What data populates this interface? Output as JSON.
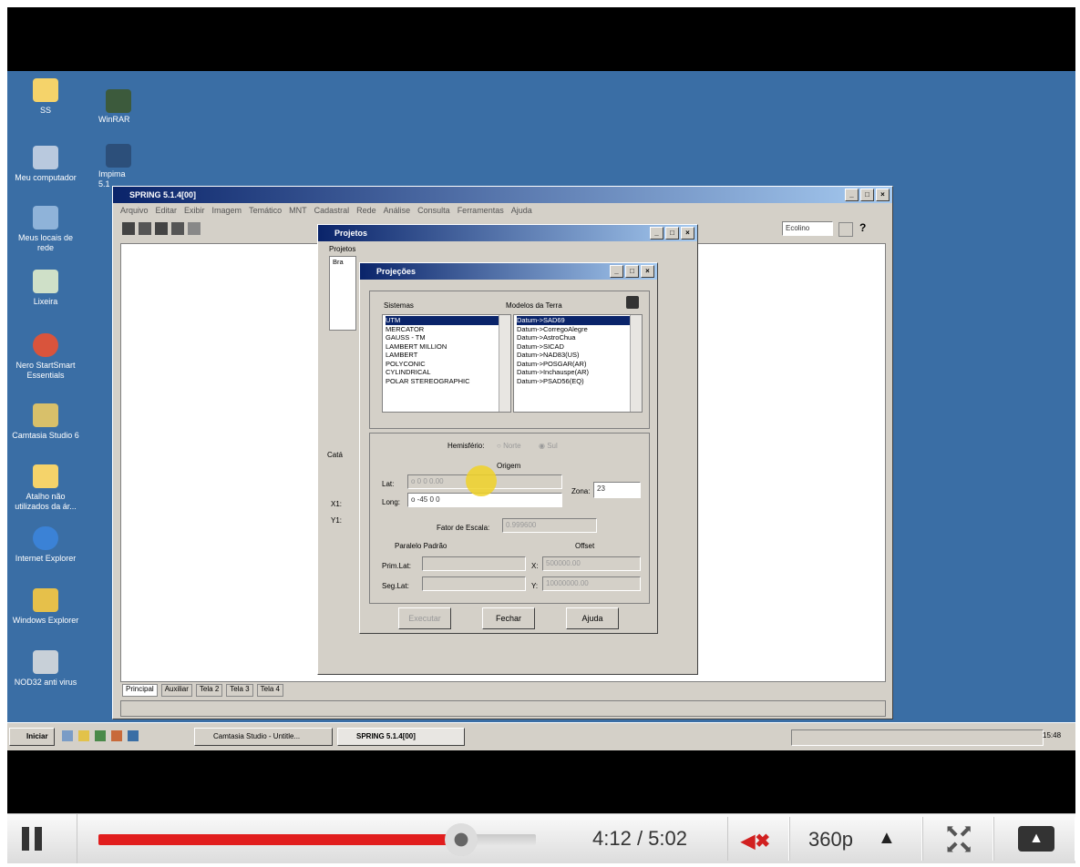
{
  "desktop_icons": [
    {
      "label": "SS"
    },
    {
      "label": "Meu computador"
    },
    {
      "label": "Meus locais de rede"
    },
    {
      "label": "Lixeira"
    },
    {
      "label": "Nero StartSmart Essentials"
    },
    {
      "label": "Camtasia Studio 6"
    },
    {
      "label": "Atalho não utilizados da ár..."
    },
    {
      "label": "Internet Explorer"
    },
    {
      "label": "Windows Explorer"
    },
    {
      "label": "NOD32 anti virus"
    }
  ],
  "desktop_icons_col2": [
    {
      "label": "WinRAR"
    },
    {
      "label": "Impima 5.1"
    }
  ],
  "spring_window": {
    "title": "SPRING 5.1.4[00]",
    "menu": [
      "Arquivo",
      "Editar",
      "Exibir",
      "Imagem",
      "Temático",
      "MNT",
      "Cadastral",
      "Rede",
      "Análise",
      "Consulta",
      "Ferramentas",
      "Ajuda"
    ],
    "tabs": [
      "Principal",
      "Auxiliar",
      "Tela 2",
      "Tela 3",
      "Tela 4"
    ],
    "combo_value": "Ecolino"
  },
  "projetos_dialog": {
    "title": "Projetos",
    "group_label": "Projetos",
    "list_item": "Bra",
    "labels": {
      "cat": "Catá",
      "x1": "X1:",
      "y1": "Y1:"
    }
  },
  "projecoes_dialog": {
    "title": "Projeções",
    "sistemas_label": "Sistemas",
    "modelos_label": "Modelos da Terra",
    "sistemas": [
      "UTM",
      "MERCATOR",
      "GAUSS - TM",
      "LAMBERT MILLION",
      "LAMBERT",
      "POLYCONIC",
      "CYLINDRICAL",
      "POLAR STEREOGRAPHIC"
    ],
    "modelos": [
      "Datum->SAD69",
      "Datum->CorregoAlegre",
      "Datum->AstroChua",
      "Datum->SICAD",
      "Datum->NAD83(US)",
      "Datum->POSGAR(AR)",
      "Datum->Inchauspe(AR)",
      "Datum->PSAD56(EQ)"
    ],
    "hemisferio_label": "Hemisfério:",
    "norte_label": "Norte",
    "sul_label": "Sul",
    "origem_label": "Origem",
    "lat_label": "Lat:",
    "lat_value": "o 0 0 0.00",
    "long_label": "Long:",
    "long_value": "o -45 0 0",
    "zona_label": "Zona:",
    "zona_value": "23",
    "fator_label": "Fator de Escala:",
    "fator_value": "0.999600",
    "paralelo_label": "Paralelo Padrão",
    "offset_label": "Offset",
    "prim_lat_label": "Prim.Lat:",
    "seg_lat_label": "Seg.Lat:",
    "x_label": "X:",
    "x_value": "500000.00",
    "y_label": "Y:",
    "y_value": "10000000.00",
    "buttons": {
      "executar": "Executar",
      "fechar": "Fechar",
      "ajuda": "Ajuda"
    }
  },
  "taskbar": {
    "start_label": "Iniciar",
    "items": [
      "Camtasia Studio - Untitle...",
      "SPRING 5.1.4[00]"
    ],
    "clock": "15:48"
  },
  "player": {
    "time_current": "4:12",
    "time_separator": " / ",
    "time_total": "5:02",
    "progress": 0.83,
    "quality": "360p",
    "colors": {
      "progress": "#e11d1d",
      "muted_icon": "#d12020"
    }
  }
}
